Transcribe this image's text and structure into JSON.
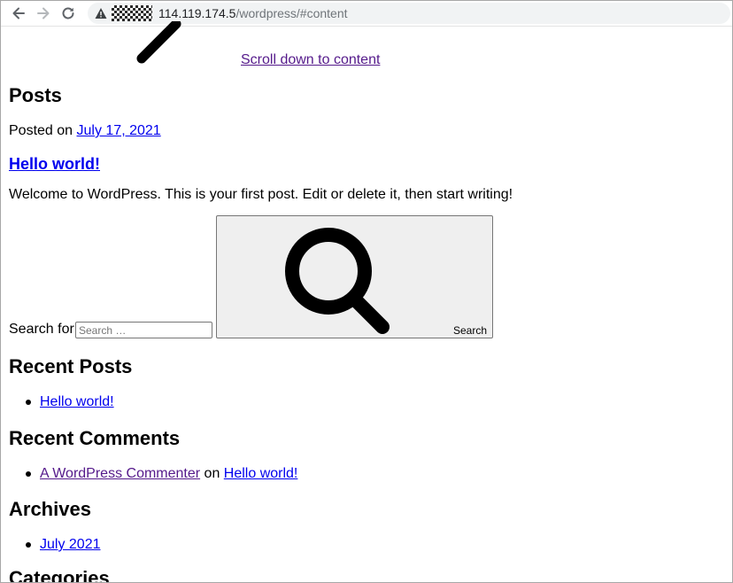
{
  "browser": {
    "url_host": "114.119.174.5",
    "url_path": "/wordpress/#content"
  },
  "page": {
    "skip_link": "Scroll down to content",
    "posts_heading": "Posts",
    "posted_on_prefix": "Posted on ",
    "posted_on_date": "July 17, 2021",
    "post_title": "Hello world!",
    "post_excerpt": "Welcome to WordPress. This is your first post. Edit or delete it, then start writing!",
    "search": {
      "label": "Search for:",
      "placeholder": "Search …",
      "button_label": "Search"
    },
    "recent_posts": {
      "heading": "Recent Posts",
      "items": [
        "Hello world!"
      ]
    },
    "recent_comments": {
      "heading": "Recent Comments",
      "items": [
        {
          "author": "A WordPress Commenter",
          "connector": " on ",
          "post": "Hello world!"
        }
      ]
    },
    "archives": {
      "heading": "Archives",
      "items": [
        "July 2021"
      ]
    },
    "categories": {
      "heading": "Categories"
    }
  }
}
